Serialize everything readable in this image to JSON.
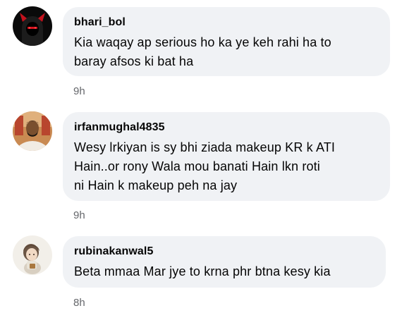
{
  "comments": [
    {
      "author": "bhari_bol",
      "text_lines": [
        "Kia waqay ap serious ho ka ye keh rahi ha to",
        "baray afsos ki bat ha"
      ],
      "time": "9h",
      "avatar_icon": "devil-hood-avatar-icon"
    },
    {
      "author": "irfanmughal4835",
      "text_lines": [
        "Wesy lrkiyan is sy bhi ziada makeup KR k ATI",
        "Hain..or rony Wala mou banati Hain lkn roti",
        "ni Hain k makeup peh na jay"
      ],
      "time": "9h",
      "avatar_icon": "man-photo-avatar-icon"
    },
    {
      "author": "rubinakanwal5",
      "text_lines": [
        "Beta mmaa Mar jye to krna phr btna kesy kia"
      ],
      "time": "8h",
      "avatar_icon": "girl-cartoon-avatar-icon"
    }
  ],
  "colors": {
    "bubble": "#f0f2f5",
    "text": "#050505",
    "secondary": "#65676b"
  }
}
